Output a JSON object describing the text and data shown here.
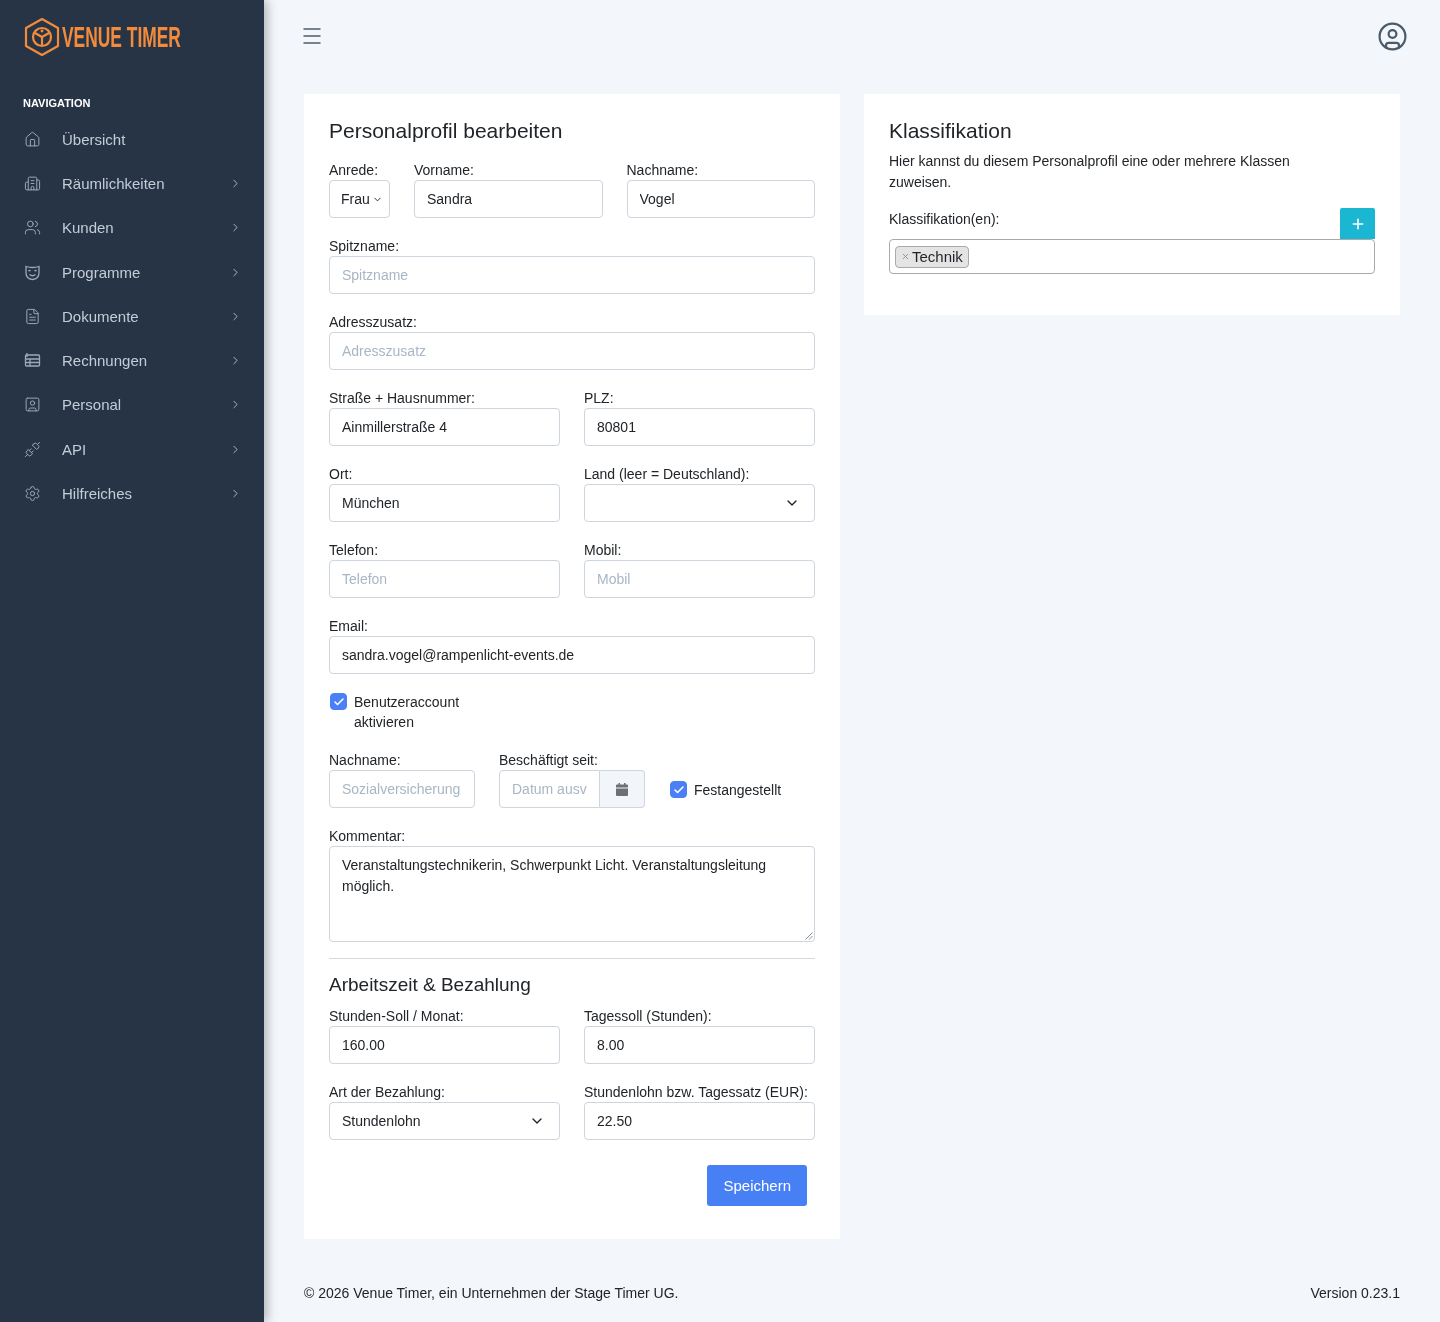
{
  "sidebar": {
    "logo": "VENUE TIMER",
    "section_title": "NAVIGATION",
    "items": [
      {
        "label": "Übersicht",
        "submenu": false
      },
      {
        "label": "Räumlichkeiten",
        "submenu": true
      },
      {
        "label": "Kunden",
        "submenu": true
      },
      {
        "label": "Programme",
        "submenu": true
      },
      {
        "label": "Dokumente",
        "submenu": true
      },
      {
        "label": "Rechnungen",
        "submenu": true
      },
      {
        "label": "Personal",
        "submenu": true
      },
      {
        "label": "API",
        "submenu": true
      },
      {
        "label": "Hilfreiches",
        "submenu": true
      }
    ]
  },
  "profile_form": {
    "title": "Personalprofil bearbeiten",
    "salutation": {
      "label": "Anrede:",
      "value": "Frau"
    },
    "first_name": {
      "label": "Vorname:",
      "value": "Sandra"
    },
    "last_name": {
      "label": "Nachname:",
      "value": "Vogel"
    },
    "nickname": {
      "label": "Spitzname:",
      "placeholder": "Spitzname"
    },
    "address_extra": {
      "label": "Adresszusatz:",
      "placeholder": "Adresszusatz"
    },
    "street": {
      "label": "Straße + Hausnummer:",
      "value": "Ainmillerstraße 4"
    },
    "zip": {
      "label": "PLZ:",
      "value": "80801"
    },
    "city": {
      "label": "Ort:",
      "value": "München"
    },
    "country": {
      "label": "Land (leer = Deutschland):"
    },
    "phone": {
      "label": "Telefon:",
      "placeholder": "Telefon"
    },
    "mobile": {
      "label": "Mobil:",
      "placeholder": "Mobil"
    },
    "email": {
      "label": "Email:",
      "value": "sandra.vogel@rampenlicht-events.de"
    },
    "user_account": {
      "label": "Benutzeraccount aktivieren",
      "checked": true
    },
    "social_insurance": {
      "label": "Nachname:",
      "placeholder": "Sozialversicherung"
    },
    "employed_since": {
      "label": "Beschäftigt seit:",
      "placeholder": "Datum ausv"
    },
    "permanent": {
      "label": "Festangestellt",
      "checked": true
    },
    "comment": {
      "label": "Kommentar:",
      "value": "Veranstaltungstechnikerin, Schwerpunkt Licht. Veranstaltungsleitung möglich."
    },
    "pay": {
      "title": "Arbeitszeit & Bezahlung",
      "monthly_hours": {
        "label": "Stunden-Soll / Monat:",
        "value": "160.00"
      },
      "daily_hours": {
        "label": "Tagessoll (Stunden):",
        "value": "8.00"
      },
      "payment_type": {
        "label": "Art der Bezahlung:",
        "value": "Stundenlohn"
      },
      "rate": {
        "label": "Stundenlohn bzw. Tagessatz (EUR):",
        "value": "22.50"
      }
    },
    "save_button": "Speichern"
  },
  "classification": {
    "title": "Klassifikation",
    "description": "Hier kannst du diesem Personalprofil eine oder mehrere Klassen zuweisen.",
    "field_label": "Klassifikation(en):",
    "tags": [
      {
        "label": "Technik"
      }
    ]
  },
  "footer": {
    "copyright": "© 2026 Venue Timer, ein Unternehmen der Stage Timer UG.",
    "version": "Version 0.23.1"
  }
}
